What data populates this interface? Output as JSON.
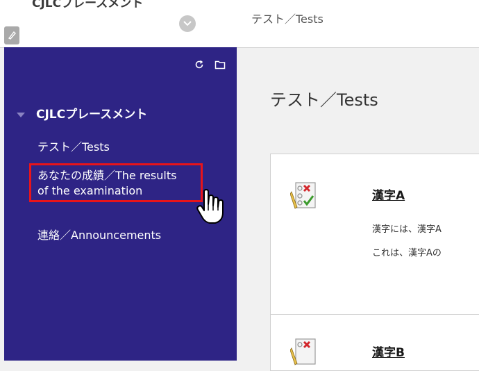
{
  "header": {
    "course_name": "CJLCプレースメント",
    "breadcrumb": "テスト／Tests"
  },
  "sidebar": {
    "course_heading": "CJLCプレースメント",
    "items": [
      {
        "label": "テスト／Tests"
      },
      {
        "label_line1": "あなたの成績／The results",
        "label_line2": "of the examination"
      },
      {
        "label": "連絡／Announcements"
      }
    ]
  },
  "main": {
    "page_title": "テスト／Tests",
    "tests": [
      {
        "title": "漢字A",
        "desc1": "漢字には、漢字A",
        "desc2": "これは、漢字Aの"
      },
      {
        "title": "漢字B"
      }
    ]
  },
  "colors": {
    "sidebar_bg": "#2e2485",
    "highlight": "#e8141a"
  },
  "icons": [
    "pencil-icon",
    "chevron-down-icon",
    "refresh-icon",
    "folder-icon",
    "test-checklist-icon",
    "hand-pointer-icon"
  ]
}
